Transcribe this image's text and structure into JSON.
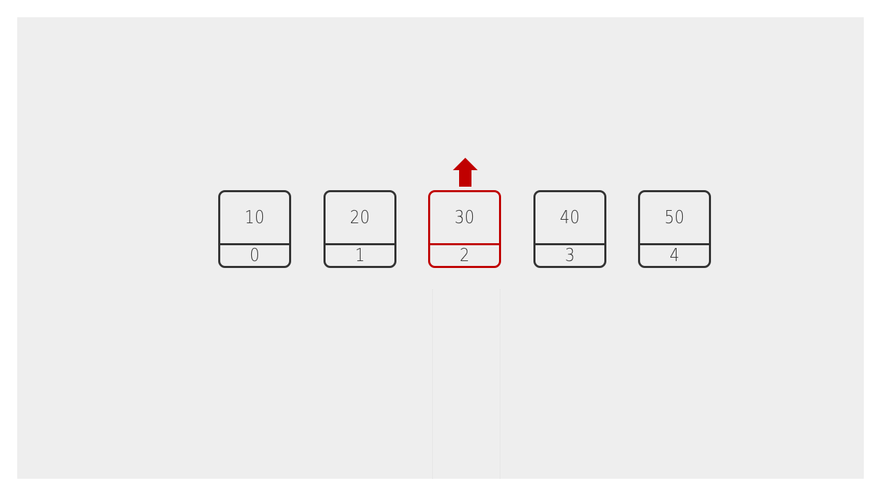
{
  "array": {
    "cells": [
      {
        "value": "10",
        "index": "0"
      },
      {
        "value": "20",
        "index": "1"
      },
      {
        "value": "30",
        "index": "2"
      },
      {
        "value": "40",
        "index": "3"
      },
      {
        "value": "50",
        "index": "4"
      }
    ],
    "highlighted_index": 2
  },
  "colors": {
    "background": "#eeeeee",
    "cell_border": "#333333",
    "highlight": "#c00000"
  },
  "icons": {
    "pointer": "arrow-up-icon"
  }
}
